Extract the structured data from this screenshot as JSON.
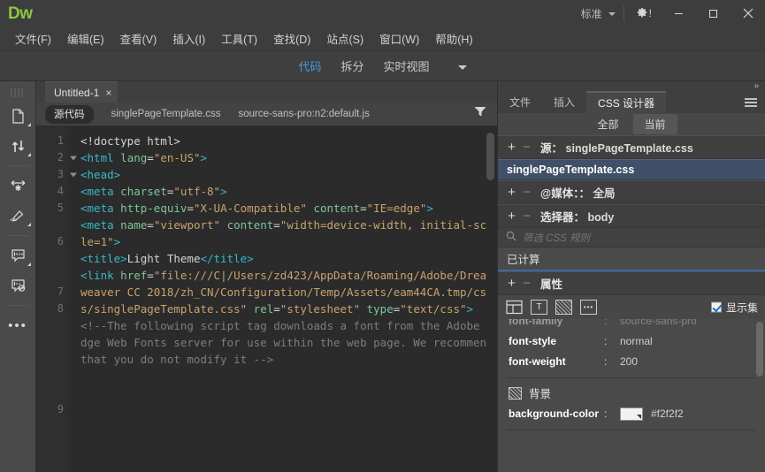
{
  "titlebar": {
    "logo": "Dw",
    "workspace": "标准",
    "gear_label": "!",
    "minimize": "minimize-icon",
    "maximize": "maximize-icon",
    "close": "close-icon"
  },
  "menubar": {
    "items": [
      {
        "label": "文件(F)"
      },
      {
        "label": "编辑(E)"
      },
      {
        "label": "查看(V)"
      },
      {
        "label": "插入(I)"
      },
      {
        "label": "工具(T)"
      },
      {
        "label": "查找(D)"
      },
      {
        "label": "站点(S)"
      },
      {
        "label": "窗口(W)"
      },
      {
        "label": "帮助(H)"
      }
    ]
  },
  "viewbar": {
    "tabs": [
      {
        "label": "代码",
        "active": true
      },
      {
        "label": "拆分",
        "active": false
      },
      {
        "label": "实时视图",
        "active": false
      }
    ]
  },
  "left_toolbar": {
    "items": [
      {
        "name": "open-documents-icon"
      },
      {
        "name": "sync-scroll-icon"
      },
      {
        "name": "word-wrap-icon"
      },
      {
        "name": "format-source-icon"
      },
      {
        "name": "apply-comment-icon"
      },
      {
        "name": "remove-comment-icon"
      },
      {
        "name": "more-options-icon",
        "glyph": "•••"
      }
    ]
  },
  "editor": {
    "doc_tab": {
      "title": "Untitled-1",
      "close": "×"
    },
    "related_files": {
      "source_pill": "源代码",
      "files": [
        "singlePageTemplate.css",
        "source-sans-pro:n2:default.js"
      ],
      "filter_icon": "filter-icon"
    },
    "lines": [
      {
        "num": "1",
        "fold": false
      },
      {
        "num": "2",
        "fold": true
      },
      {
        "num": "3",
        "fold": true
      },
      {
        "num": "4",
        "fold": false
      },
      {
        "num": "5",
        "fold": false
      },
      {
        "num": "",
        "fold": false
      },
      {
        "num": "6",
        "fold": false
      },
      {
        "num": "",
        "fold": false
      },
      {
        "num": "",
        "fold": false
      },
      {
        "num": "7",
        "fold": false
      },
      {
        "num": "8",
        "fold": false
      },
      {
        "num": "",
        "fold": false
      },
      {
        "num": "",
        "fold": false
      },
      {
        "num": "",
        "fold": false
      },
      {
        "num": "",
        "fold": false
      },
      {
        "num": "",
        "fold": false
      },
      {
        "num": "9",
        "fold": false
      },
      {
        "num": "",
        "fold": false
      },
      {
        "num": "",
        "fold": false
      },
      {
        "num": "",
        "fold": false
      }
    ],
    "code": [
      {
        "tokens": [
          {
            "t": "<!doctype html>",
            "c": "plain"
          }
        ]
      },
      {
        "tokens": [
          {
            "t": "<html",
            "c": "tag"
          },
          {
            "t": " lang",
            "c": "attr"
          },
          {
            "t": "=",
            "c": "plain"
          },
          {
            "t": "\"en-US\"",
            "c": "val"
          },
          {
            "t": ">",
            "c": "tag"
          }
        ]
      },
      {
        "tokens": [
          {
            "t": "<head>",
            "c": "tag"
          }
        ]
      },
      {
        "tokens": [
          {
            "t": "<meta",
            "c": "tag"
          },
          {
            "t": " charset",
            "c": "attr"
          },
          {
            "t": "=",
            "c": "plain"
          },
          {
            "t": "\"utf-8\"",
            "c": "val"
          },
          {
            "t": ">",
            "c": "tag"
          }
        ]
      },
      {
        "tokens": [
          {
            "t": "<meta",
            "c": "tag"
          },
          {
            "t": " http-equiv",
            "c": "attr"
          },
          {
            "t": "=",
            "c": "plain"
          },
          {
            "t": "\"X-UA-Compatible\" ",
            "c": "val"
          },
          {
            "t": "content",
            "c": "attr"
          },
          {
            "t": "=",
            "c": "plain"
          },
          {
            "t": "\"IE=edge\"",
            "c": "val"
          },
          {
            "t": ">",
            "c": "tag"
          }
        ]
      },
      {
        "tokens": [
          {
            "t": "<meta",
            "c": "tag"
          },
          {
            "t": " name",
            "c": "attr"
          },
          {
            "t": "=",
            "c": "plain"
          },
          {
            "t": "\"viewport\" ",
            "c": "val"
          },
          {
            "t": "content",
            "c": "attr"
          },
          {
            "t": "=",
            "c": "plain"
          },
          {
            "t": "\"width=device-width, initial-scale=1\"",
            "c": "val"
          },
          {
            "t": ">",
            "c": "tag"
          }
        ]
      },
      {
        "tokens": [
          {
            "t": "<title>",
            "c": "tag"
          },
          {
            "t": "Light Theme",
            "c": "plain"
          },
          {
            "t": "</title>",
            "c": "tag"
          }
        ]
      },
      {
        "tokens": [
          {
            "t": "<link",
            "c": "tag"
          },
          {
            "t": " href",
            "c": "attr"
          },
          {
            "t": "=",
            "c": "plain"
          },
          {
            "t": "\"file:///C|/Users/zd423/AppData/Roaming/Adobe/Dreamweaver CC 2018/zh_CN/Configuration/Temp/Assets/eam44CA.tmp/css/singlePageTemplate.css\" ",
            "c": "val"
          },
          {
            "t": "rel",
            "c": "attr"
          },
          {
            "t": "=",
            "c": "plain"
          },
          {
            "t": "\"stylesheet\" ",
            "c": "val"
          },
          {
            "t": "type",
            "c": "attr"
          },
          {
            "t": "=",
            "c": "plain"
          },
          {
            "t": "\"text/css\"",
            "c": "val"
          },
          {
            "t": ">",
            "c": "tag"
          }
        ]
      },
      {
        "tokens": [
          {
            "t": "<!--The following script tag downloads a font from the Adobe Edge Web Fonts server for use within the web page. We recommend that you do not modify it -->",
            "c": "cmt"
          }
        ]
      }
    ]
  },
  "right_panel": {
    "chevrons": "»",
    "tabs": [
      {
        "label": "文件",
        "active": false
      },
      {
        "label": "插入",
        "active": false
      },
      {
        "label": "CSS 设计器",
        "active": true
      }
    ],
    "menu_icon": "hamburger-menu-icon",
    "scope": {
      "all": "全部",
      "current": "当前",
      "selected": "当前"
    },
    "sources": {
      "header_label": "源",
      "header_value": "singlePageTemplate.css",
      "selected_item": "singlePageTemplate.css"
    },
    "media": {
      "header_label": "@媒体",
      "header_value": "全局"
    },
    "selectors": {
      "header_label": "选择器",
      "header_value": "body"
    },
    "filter_placeholder": "筛选 CSS 规则",
    "computed_label": "已计算",
    "properties": {
      "header_label": "属性",
      "category_icons": [
        {
          "name": "layout-category-icon"
        },
        {
          "name": "text-category-icon",
          "glyph": "T"
        },
        {
          "name": "background-category-icon"
        },
        {
          "name": "more-category-icon",
          "glyph": "•••"
        }
      ],
      "show_set_label": "显示集",
      "show_set_checked": true,
      "rows": [
        {
          "name": "font-family",
          "value": "source-sans-pro",
          "clipped": true
        },
        {
          "name": "font-style",
          "value": "normal",
          "clipped": false
        },
        {
          "name": "font-weight",
          "value": "200",
          "clipped": false
        }
      ],
      "background_group": {
        "title": "背景",
        "rows": [
          {
            "name": "background-color",
            "value": "#f2f2f2",
            "swatch": "#f2f2f2"
          }
        ]
      }
    }
  },
  "colors": {
    "accent_blue": "#3d9ae2",
    "logo_green": "#8ec641",
    "selection_blue": "#3f5068",
    "editor_bg": "#2b2b2b",
    "panel_bg": "#474747",
    "chrome_bg": "#3f3f3f"
  }
}
